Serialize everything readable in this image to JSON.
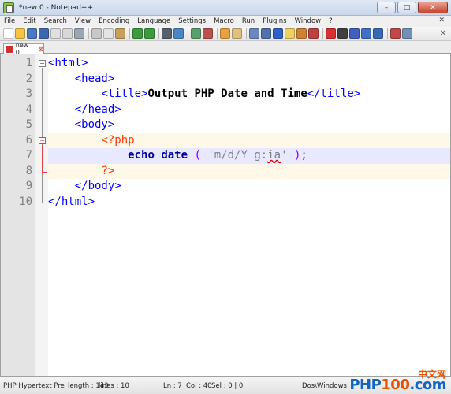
{
  "window": {
    "title": "*new  0 - Notepad++",
    "minimize": "–",
    "maximize": "□",
    "close": "✕"
  },
  "menu": {
    "items": [
      "File",
      "Edit",
      "Search",
      "View",
      "Encoding",
      "Language",
      "Settings",
      "Macro",
      "Run",
      "Plugins",
      "Window",
      "?"
    ],
    "close_glyph": "✕"
  },
  "toolbar": {
    "close_glyph": "✕",
    "icons": [
      {
        "name": "new-file-icon",
        "color": "#ffffff"
      },
      {
        "name": "open-file-icon",
        "color": "#f5c542"
      },
      {
        "name": "save-icon",
        "color": "#4a78c2"
      },
      {
        "name": "save-all-icon",
        "color": "#3a68b2"
      },
      {
        "name": "close-file-icon",
        "color": "#e0e0e0"
      },
      {
        "name": "close-all-icon",
        "color": "#d8d8d8"
      },
      {
        "name": "print-icon",
        "color": "#9aa6b4"
      },
      {
        "name": "sep"
      },
      {
        "name": "cut-icon",
        "color": "#c8c8c8"
      },
      {
        "name": "copy-icon",
        "color": "#e4e4e4"
      },
      {
        "name": "paste-icon",
        "color": "#c9a05a"
      },
      {
        "name": "sep"
      },
      {
        "name": "undo-icon",
        "color": "#3d9b3d"
      },
      {
        "name": "redo-icon",
        "color": "#3d9b3d"
      },
      {
        "name": "sep"
      },
      {
        "name": "find-icon",
        "color": "#555f6e"
      },
      {
        "name": "replace-icon",
        "color": "#4a86c5"
      },
      {
        "name": "sep"
      },
      {
        "name": "zoom-in-icon",
        "color": "#5aa06a"
      },
      {
        "name": "zoom-out-icon",
        "color": "#c05050"
      },
      {
        "name": "sep"
      },
      {
        "name": "sync-v-icon",
        "color": "#e8a040"
      },
      {
        "name": "sync-h-icon",
        "color": "#e0c080"
      },
      {
        "name": "sep"
      },
      {
        "name": "word-wrap-icon",
        "color": "#6a88c0"
      },
      {
        "name": "show-all-chars-icon",
        "color": "#5070b0"
      },
      {
        "name": "indent-guide-icon",
        "color": "#2f62c8"
      },
      {
        "name": "udl-icon",
        "color": "#f2d060"
      },
      {
        "name": "doc-map-icon",
        "color": "#d08030"
      },
      {
        "name": "function-list-icon",
        "color": "#c04040"
      },
      {
        "name": "sep"
      },
      {
        "name": "record-macro-icon",
        "color": "#d83030"
      },
      {
        "name": "stop-macro-icon",
        "color": "#404040"
      },
      {
        "name": "play-macro-icon",
        "color": "#4060c0"
      },
      {
        "name": "run-macro-multiple-icon",
        "color": "#4070c8"
      },
      {
        "name": "save-macro-icon",
        "color": "#3a68b2"
      },
      {
        "name": "sep"
      },
      {
        "name": "spell-check-icon",
        "color": "#c04848"
      },
      {
        "name": "extra-icon",
        "color": "#7090b8"
      }
    ]
  },
  "tab": {
    "label": "new  0",
    "close_glyph": "⊠"
  },
  "editor": {
    "lines": [
      {
        "n": "1",
        "tokens": [
          [
            "tag",
            "<html>"
          ]
        ]
      },
      {
        "n": "2",
        "tokens": [
          [
            "txt-plain",
            "    "
          ],
          [
            "tag",
            "<head>"
          ]
        ]
      },
      {
        "n": "3",
        "tokens": [
          [
            "txt-plain",
            "        "
          ],
          [
            "tag",
            "<title>"
          ],
          [
            "txt",
            "Output PHP Date and Time"
          ],
          [
            "tag",
            "</title>"
          ]
        ]
      },
      {
        "n": "4",
        "tokens": [
          [
            "txt-plain",
            "    "
          ],
          [
            "tag",
            "</head>"
          ]
        ]
      },
      {
        "n": "5",
        "tokens": [
          [
            "txt-plain",
            "    "
          ],
          [
            "tag",
            "<body>"
          ]
        ]
      },
      {
        "n": "6",
        "tokens": [
          [
            "txt-plain",
            "        "
          ],
          [
            "php-tag",
            "<?php"
          ]
        ]
      },
      {
        "n": "7",
        "tokens": [
          [
            "txt-plain",
            "            "
          ],
          [
            "kw",
            "echo"
          ],
          [
            "txt-plain",
            " "
          ],
          [
            "kw",
            "date"
          ],
          [
            "txt-plain",
            " "
          ],
          [
            "paren",
            "("
          ],
          [
            "txt-plain",
            " "
          ],
          [
            "str",
            "'m/d/Y g:"
          ],
          [
            "str-squiggle",
            "ia"
          ],
          [
            "str",
            "'"
          ],
          [
            "txt-plain",
            " "
          ],
          [
            "paren",
            ");"
          ]
        ]
      },
      {
        "n": "8",
        "tokens": [
          [
            "txt-plain",
            "        "
          ],
          [
            "php-tag",
            "?>"
          ]
        ]
      },
      {
        "n": "9",
        "tokens": [
          [
            "txt-plain",
            "    "
          ],
          [
            "tag",
            "</body>"
          ]
        ]
      },
      {
        "n": "10",
        "tokens": [
          [
            "tag",
            "</html>"
          ]
        ]
      }
    ]
  },
  "status": {
    "lang": "PHP Hypertext Pre",
    "length": "length : 143",
    "lines": "lines : 10",
    "ln": "Ln : 7",
    "col": "Col : 40",
    "sel": "Sel : 0 | 0",
    "eol": "Dos\\Windows"
  },
  "watermark": {
    "cn": "中文网",
    "php": "PHP",
    "num": "100",
    "dot": ".",
    "com": "com"
  }
}
